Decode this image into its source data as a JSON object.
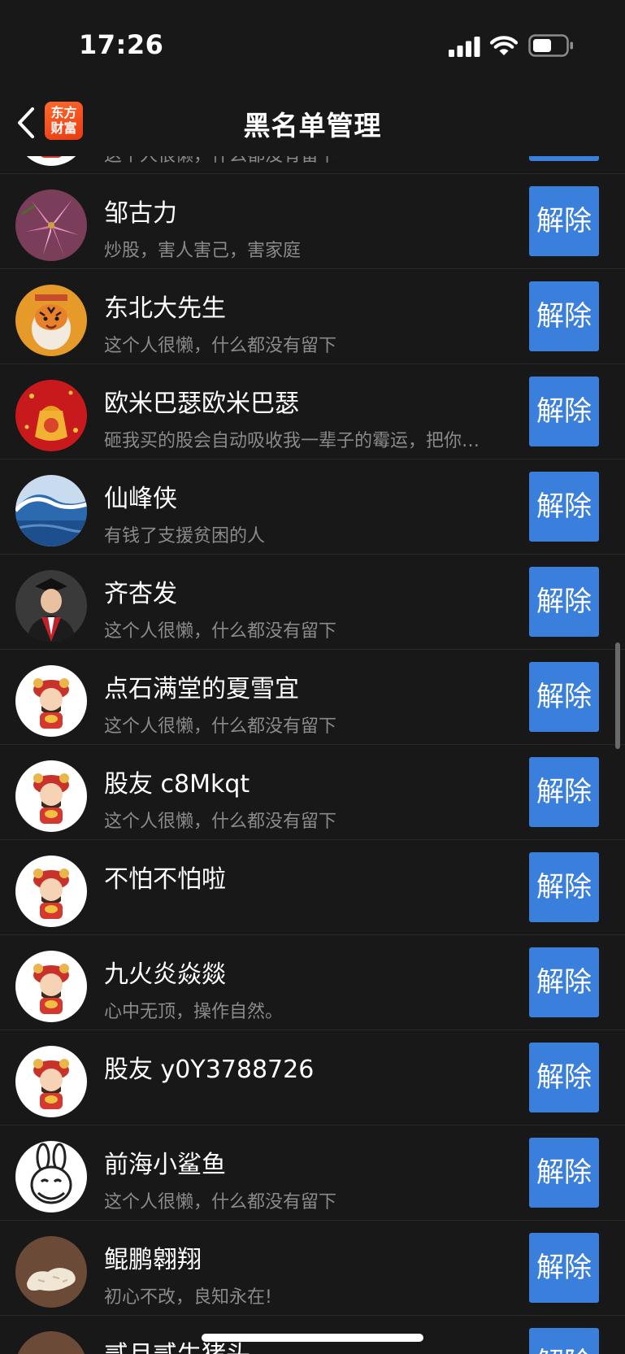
{
  "status_bar": {
    "time": "17:26"
  },
  "nav": {
    "title": "黑名单管理",
    "logo_line1": "东方",
    "logo_line2": "财富"
  },
  "button_label": "解除",
  "rows": [
    {
      "name": "",
      "bio": "这个人很懒，什么都没有留下",
      "avatar": "cartoon-god-of-wealth"
    },
    {
      "name": "邹古力",
      "bio": "炒股，害人害己，害家庭",
      "avatar": "pink-lily-flower"
    },
    {
      "name": "东北大先生",
      "bio": "这个人很懒，什么都没有留下",
      "avatar": "tiger-painting"
    },
    {
      "name": "欧米巴瑟欧米巴瑟",
      "bio": "砸我买的股会自动吸收我一辈子的霉运，把你…",
      "avatar": "red-fortune-bag"
    },
    {
      "name": "仙峰侠",
      "bio": "有钱了支援贫困的人",
      "avatar": "ocean-wave"
    },
    {
      "name": "齐杏发",
      "bio": "这个人很懒，什么都没有留下",
      "avatar": "graduate-portrait"
    },
    {
      "name": "点石满堂的夏雪宜",
      "bio": "这个人很懒，什么都没有留下",
      "avatar": "cartoon-god-of-wealth"
    },
    {
      "name": "股友 c8Mkqt",
      "bio": "这个人很懒，什么都没有留下",
      "avatar": "cartoon-god-of-wealth"
    },
    {
      "name": "不怕不怕啦",
      "bio": "",
      "avatar": "cartoon-god-of-wealth"
    },
    {
      "name": "九火炎焱燚",
      "bio": "心中无顶，操作自然。",
      "avatar": "cartoon-god-of-wealth"
    },
    {
      "name": "股友 y0Y3788726",
      "bio": "",
      "avatar": "cartoon-god-of-wealth"
    },
    {
      "name": "前海小鲨鱼",
      "bio": "这个人很懒，什么都没有留下",
      "avatar": "cartoon-rabbit"
    },
    {
      "name": "鲲鹏翱翔",
      "bio": "初心不改，良知永在!",
      "avatar": "peanut-photo"
    },
    {
      "name": "贰月贰生猪头",
      "bio": "",
      "avatar": "peanut-photo"
    }
  ],
  "colors": {
    "background": "#181818",
    "button": "#3a7fdc",
    "bio_text": "#8a8a8a"
  },
  "icons": [
    "back-chevron-icon",
    "signal-icon",
    "wifi-icon",
    "battery-icon"
  ]
}
